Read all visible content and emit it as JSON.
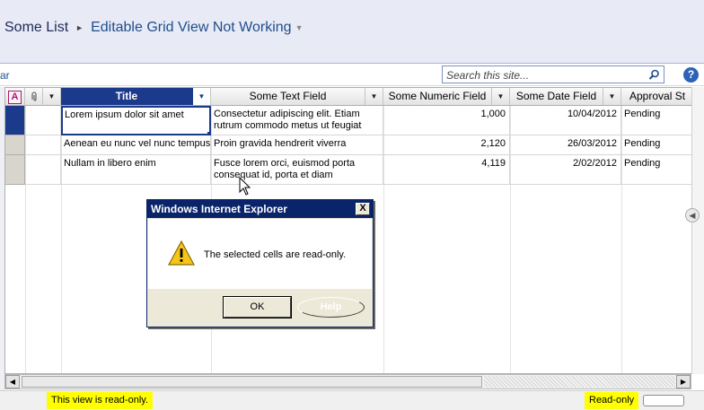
{
  "header": {
    "breadcrumb_root": "Some List",
    "breadcrumb_current": "Editable Grid View Not Working",
    "separator_icon": "chevron-right-icon",
    "dropdown_icon": "chevron-down-icon"
  },
  "toolbar": {
    "fragment_text": "ar",
    "search_placeholder": "Search this site...",
    "search_icon": "search-icon",
    "help_label": "?"
  },
  "grid": {
    "columns": [
      {
        "id": "attachments",
        "label": "A",
        "icon": "attachment-type-icon"
      },
      {
        "id": "clip",
        "label": "",
        "icon": "paperclip-icon"
      },
      {
        "id": "title",
        "label": "Title"
      },
      {
        "id": "text",
        "label": "Some Text Field"
      },
      {
        "id": "number",
        "label": "Some Numeric Field"
      },
      {
        "id": "date",
        "label": "Some Date Field"
      },
      {
        "id": "approval",
        "label": "Approval St"
      }
    ],
    "rows": [
      {
        "title": "Lorem ipsum dolor sit amet",
        "text": "Consectetur adipiscing elit. Etiam rutrum commodo metus ut feugiat",
        "number": "1,000",
        "date": "10/04/2012",
        "approval": "Pending"
      },
      {
        "title": "Aenean eu nunc vel nunc tempus",
        "text": "Proin gravida hendrerit viverra",
        "number": "2,120",
        "date": "26/03/2012",
        "approval": "Pending"
      },
      {
        "title": "Nullam in libero enim",
        "text": "Fusce lorem orci, euismod porta consequat id, porta et diam",
        "number": "4,119",
        "date": "2/02/2012",
        "approval": "Pending"
      }
    ]
  },
  "dialog": {
    "title": "Windows Internet Explorer",
    "message": "The selected cells are read-only.",
    "ok_label": "OK",
    "help_label": "Help",
    "close_label": "X",
    "icon": "warning-icon"
  },
  "status": {
    "left_text": "This view is read-only.",
    "right_text": "Read-only"
  },
  "colors": {
    "active_header": "#1c3a8c",
    "status_highlight": "#ffff00",
    "dialog_titlebar": "#0a246a"
  }
}
